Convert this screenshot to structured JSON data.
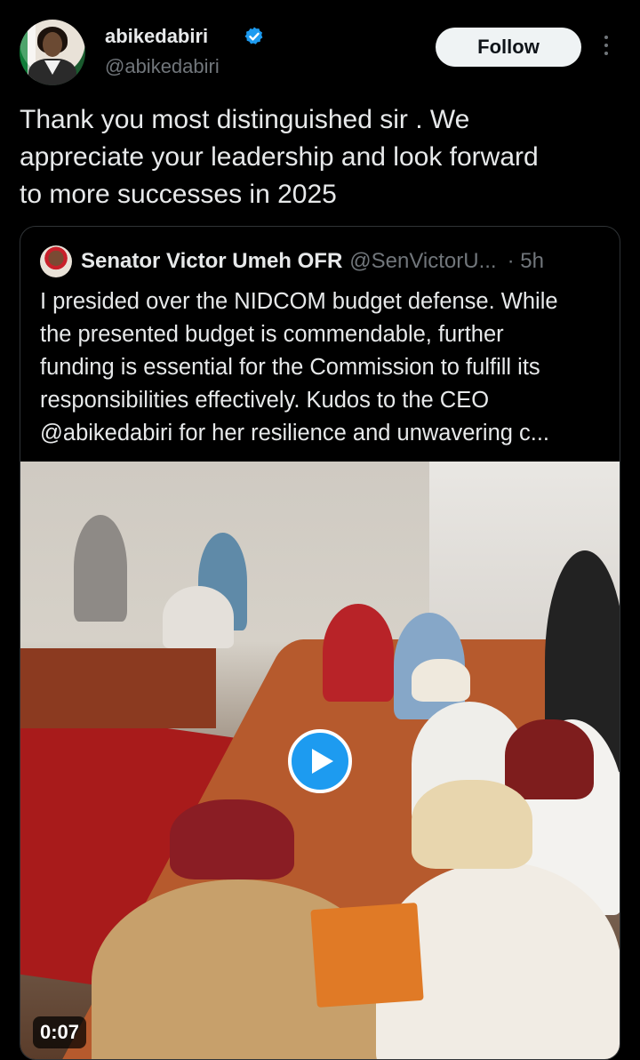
{
  "author": {
    "display_name": "abikedabiri",
    "handle": "@abikedabiri",
    "verified": true,
    "avatar_icon": "profile-photo"
  },
  "actions": {
    "follow_label": "Follow",
    "more_icon": "more-vertical-icon"
  },
  "tweet": {
    "text": "Thank you most distinguished sir . We\nappreciate your leadership and look forward\nto more successes in 2025"
  },
  "quoted": {
    "display_name": "Senator Victor Umeh OFR",
    "handle": "@SenVictorU...",
    "time": "· 5h",
    "text": "I presided over the NIDCOM budget defense. While\nthe presented budget is commendable, further\nfunding is essential for the Commission to fulfill its\nresponsibilities effectively. Kudos to the CEO\n@abikedabiri for her resilience and unwavering c...",
    "media": {
      "type": "video",
      "duration": "0:07",
      "play_icon": "play-icon"
    }
  },
  "colors": {
    "background": "#000000",
    "text": "#e7e9ea",
    "muted": "#71767b",
    "accent": "#1d9bf0",
    "border": "#2f3336"
  }
}
